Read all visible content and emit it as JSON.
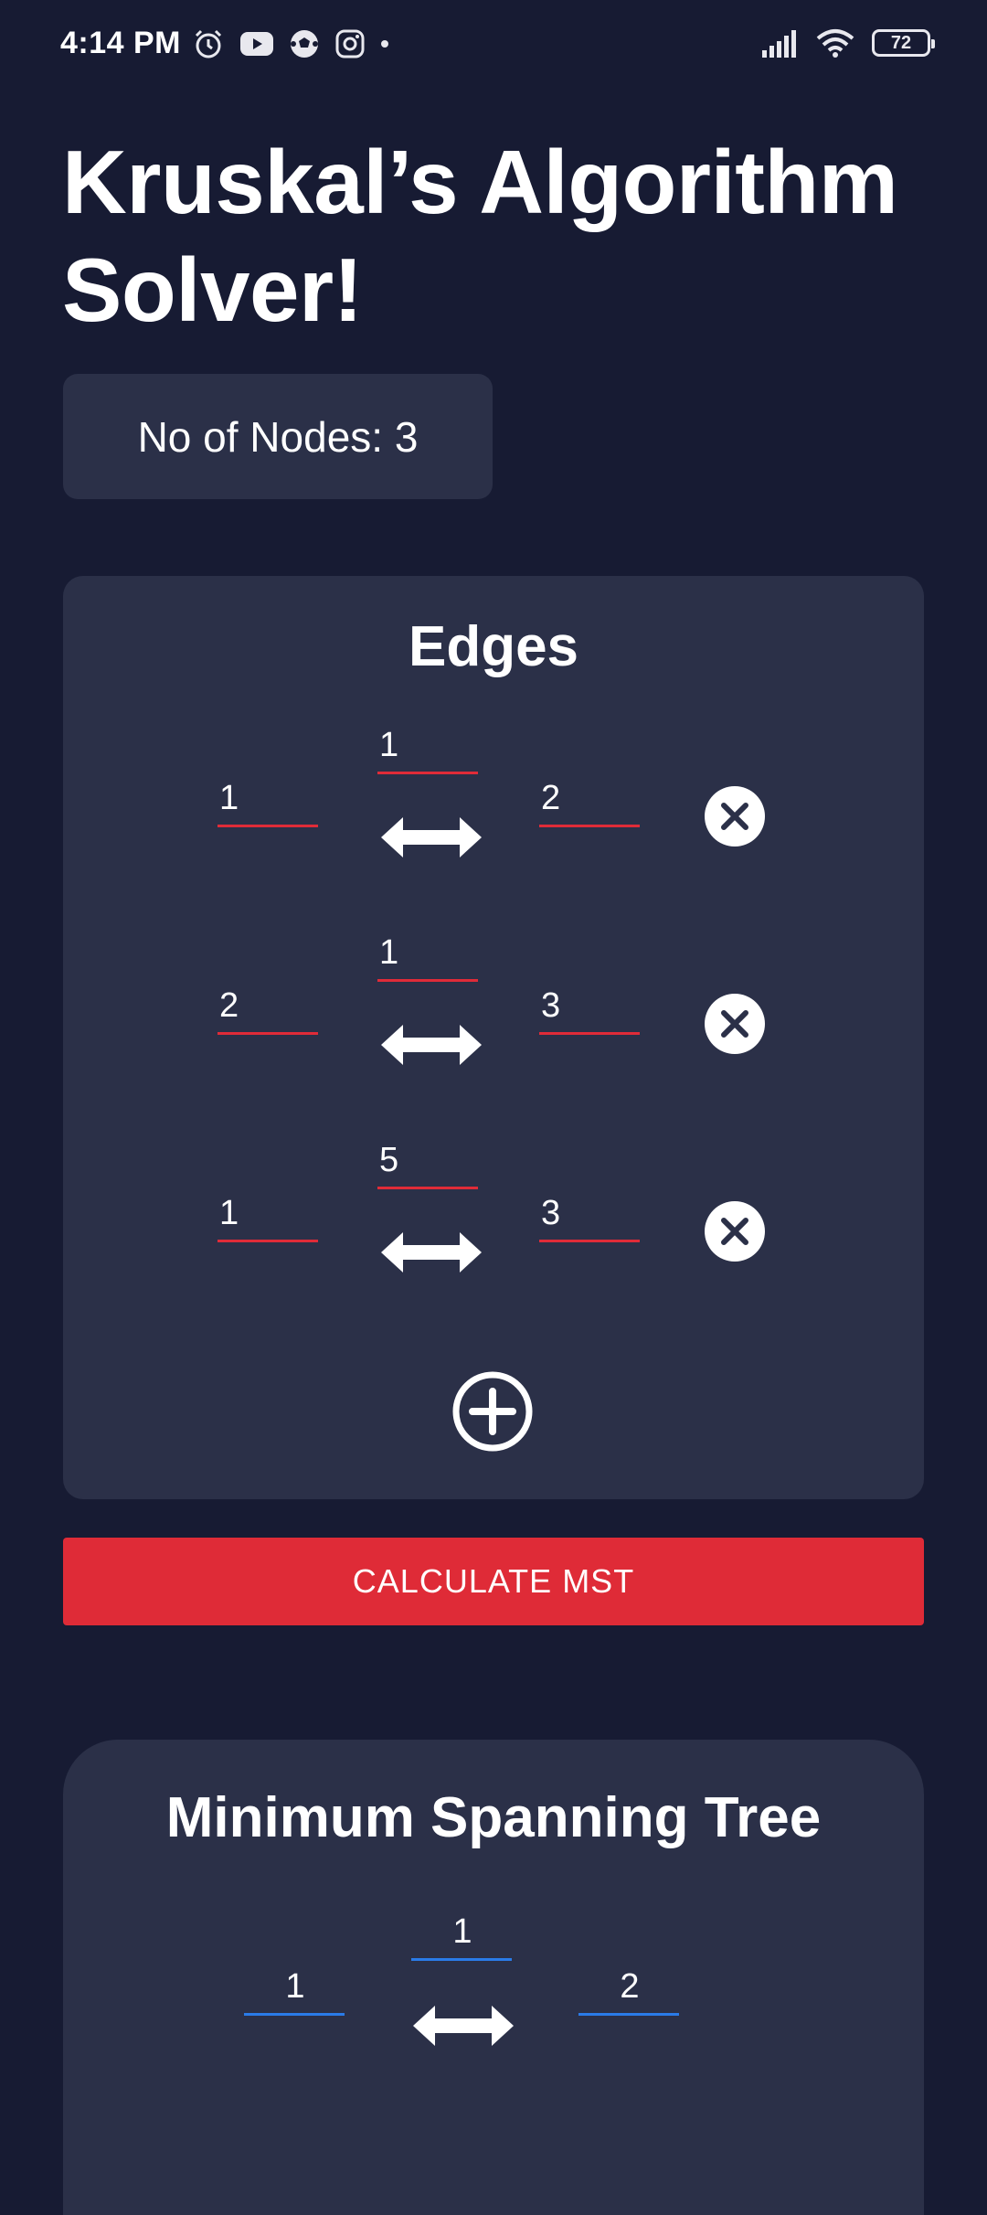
{
  "status_bar": {
    "time": "4:14 PM",
    "left_icons": [
      "alarm-icon",
      "youtube-icon",
      "soccer-ball-icon",
      "instagram-icon",
      "dot-icon"
    ],
    "right_icons": [
      "signal-icon",
      "wifi-icon",
      "battery-icon"
    ],
    "battery_level": "72"
  },
  "page": {
    "title_line1": "Kruskal’s Algorithm",
    "title_line2": "Solver!"
  },
  "nodes": {
    "label": "No of Nodes: 3"
  },
  "edges": {
    "title": "Edges",
    "rows": [
      {
        "from": "1",
        "weight": "1",
        "to": "2"
      },
      {
        "from": "2",
        "weight": "1",
        "to": "3"
      },
      {
        "from": "1",
        "weight": "5",
        "to": "3"
      }
    ]
  },
  "calculate_button": {
    "label": "CALCULATE MST"
  },
  "mst": {
    "title": "Minimum Spanning Tree",
    "rows": [
      {
        "from": "1",
        "weight": "1",
        "to": "2"
      }
    ]
  },
  "colors": {
    "background": "#171b33",
    "card": "#2b3048",
    "accent_red": "#df2b37",
    "accent_blue": "#2a7be8"
  }
}
